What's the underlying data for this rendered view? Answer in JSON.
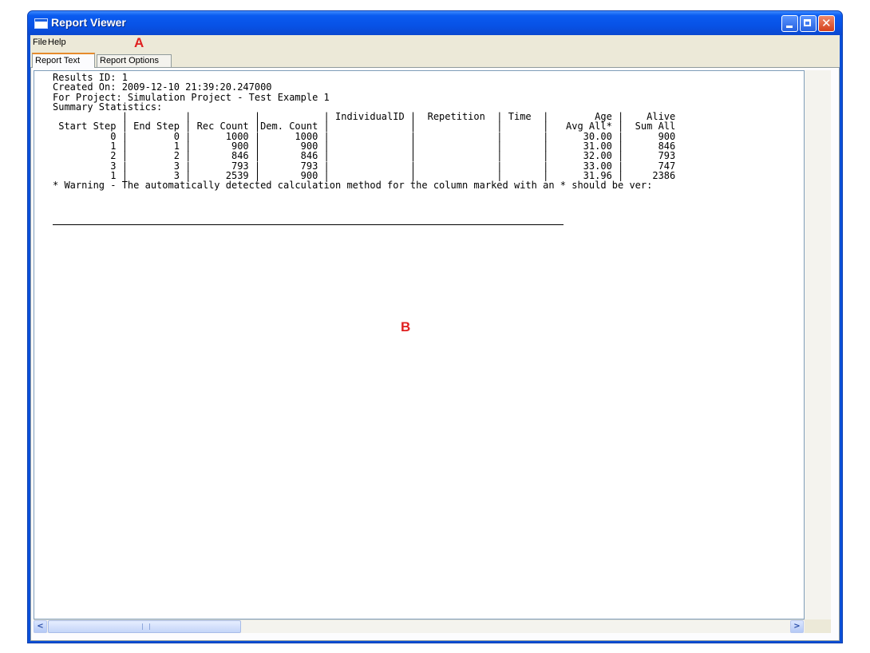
{
  "window": {
    "title": "Report Viewer"
  },
  "menu": {
    "items": [
      "File",
      "Help"
    ]
  },
  "annotations": {
    "a": "A",
    "b": "B"
  },
  "tabs": [
    {
      "label": "Report Text",
      "active": true
    },
    {
      "label": "Report Options",
      "active": false
    }
  ],
  "report": {
    "results_id": "Results ID: 1",
    "created_on": "Created On: 2009-12-10 21:39:20.247000",
    "project": "For Project: Simulation Project - Test Example 1",
    "summary_heading": "Summary Statistics:",
    "columns": [
      "Start Step",
      "End Step",
      "Rec Count",
      "Dem. Count",
      "IndividualID",
      "Repetition",
      "Time",
      "Age",
      "Alive"
    ],
    "sub_headers": {
      "Age": "Avg All*",
      "Alive": "Sum All"
    },
    "rows": [
      [
        "0",
        "0",
        "1000",
        "1000",
        "",
        "",
        "",
        "30.00",
        "900"
      ],
      [
        "1",
        "1",
        "900",
        "900",
        "",
        "",
        "",
        "31.00",
        "846"
      ],
      [
        "2",
        "2",
        "846",
        "846",
        "",
        "",
        "",
        "32.00",
        "793"
      ],
      [
        "3",
        "3",
        "793",
        "793",
        "",
        "",
        "",
        "33.00",
        "747"
      ],
      [
        "1",
        "3",
        "2539",
        "900",
        "",
        "",
        "",
        "31.96",
        "2386"
      ]
    ],
    "warning": "* Warning - The automatically detected calculation method for the column marked with an * should be ver:"
  },
  "icons": {
    "app": "window-icon",
    "minimize": "minimize-icon",
    "maximize": "maximize-icon",
    "close": "close-icon",
    "scroll_left": "arrow-left-icon",
    "scroll_right": "arrow-right-icon"
  },
  "colors": {
    "titlebar": "#0a5bf0",
    "active_tab_accent": "#e68b2c",
    "marker": "#e02020"
  }
}
